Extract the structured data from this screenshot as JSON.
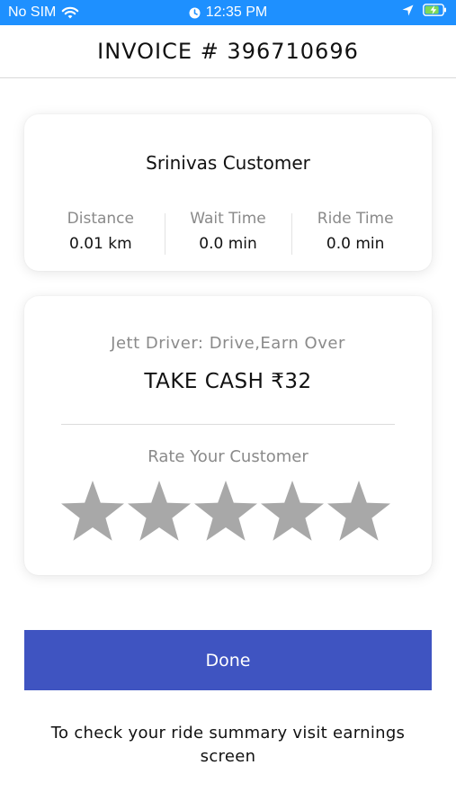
{
  "status_bar": {
    "carrier": "No SIM",
    "time": "12:35 PM",
    "icons": [
      "wifi-icon",
      "alarm-icon",
      "location-arrow-icon",
      "battery-charging-icon"
    ],
    "color": "#1e90ff"
  },
  "header": {
    "title": "INVOICE # 396710696"
  },
  "customer_card": {
    "name": "Srinivas Customer",
    "stats": [
      {
        "label": "Distance",
        "value": "0.01 km"
      },
      {
        "label": "Wait Time",
        "value": "0.0 min"
      },
      {
        "label": "Ride Time",
        "value": "0.0 min"
      }
    ]
  },
  "payment_card": {
    "company": "Jett Driver: Drive,Earn Over",
    "cash": "TAKE CASH ₹32",
    "rate_label": "Rate Your Customer",
    "rating": {
      "value": 0,
      "max": 5
    },
    "star_color": "#a8a8a8"
  },
  "done_button": {
    "label": "Done",
    "color": "#3f54c1"
  },
  "footer": {
    "note": "To check your ride summary visit earnings screen"
  }
}
